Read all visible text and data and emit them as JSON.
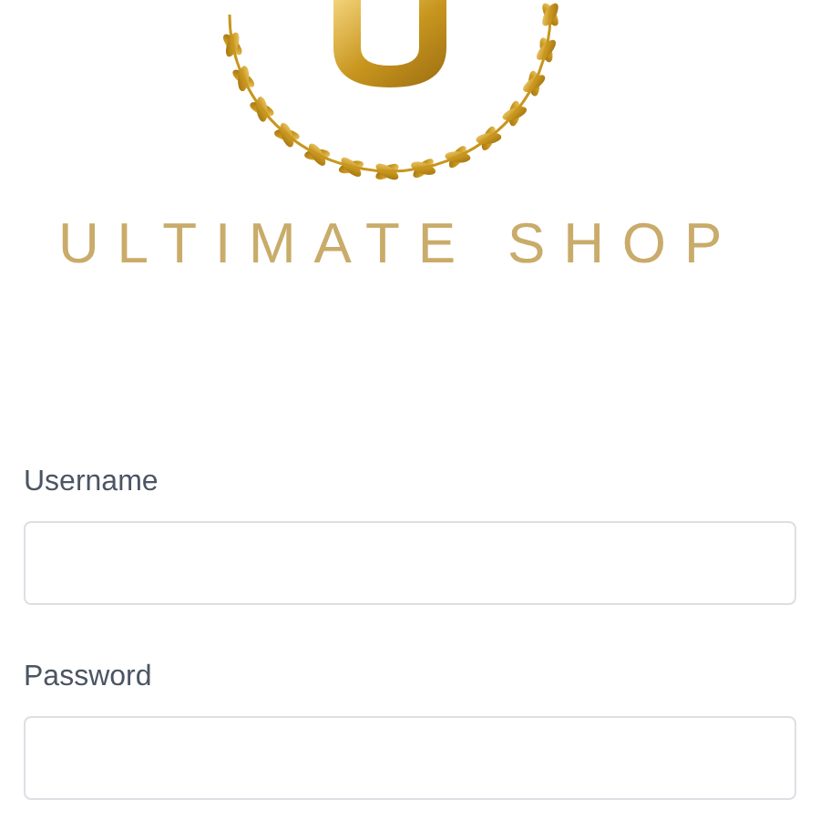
{
  "logo": {
    "text": "ULTIMATE SHOP"
  },
  "form": {
    "fields": [
      {
        "label": "Username"
      },
      {
        "label": "Password"
      }
    ]
  }
}
